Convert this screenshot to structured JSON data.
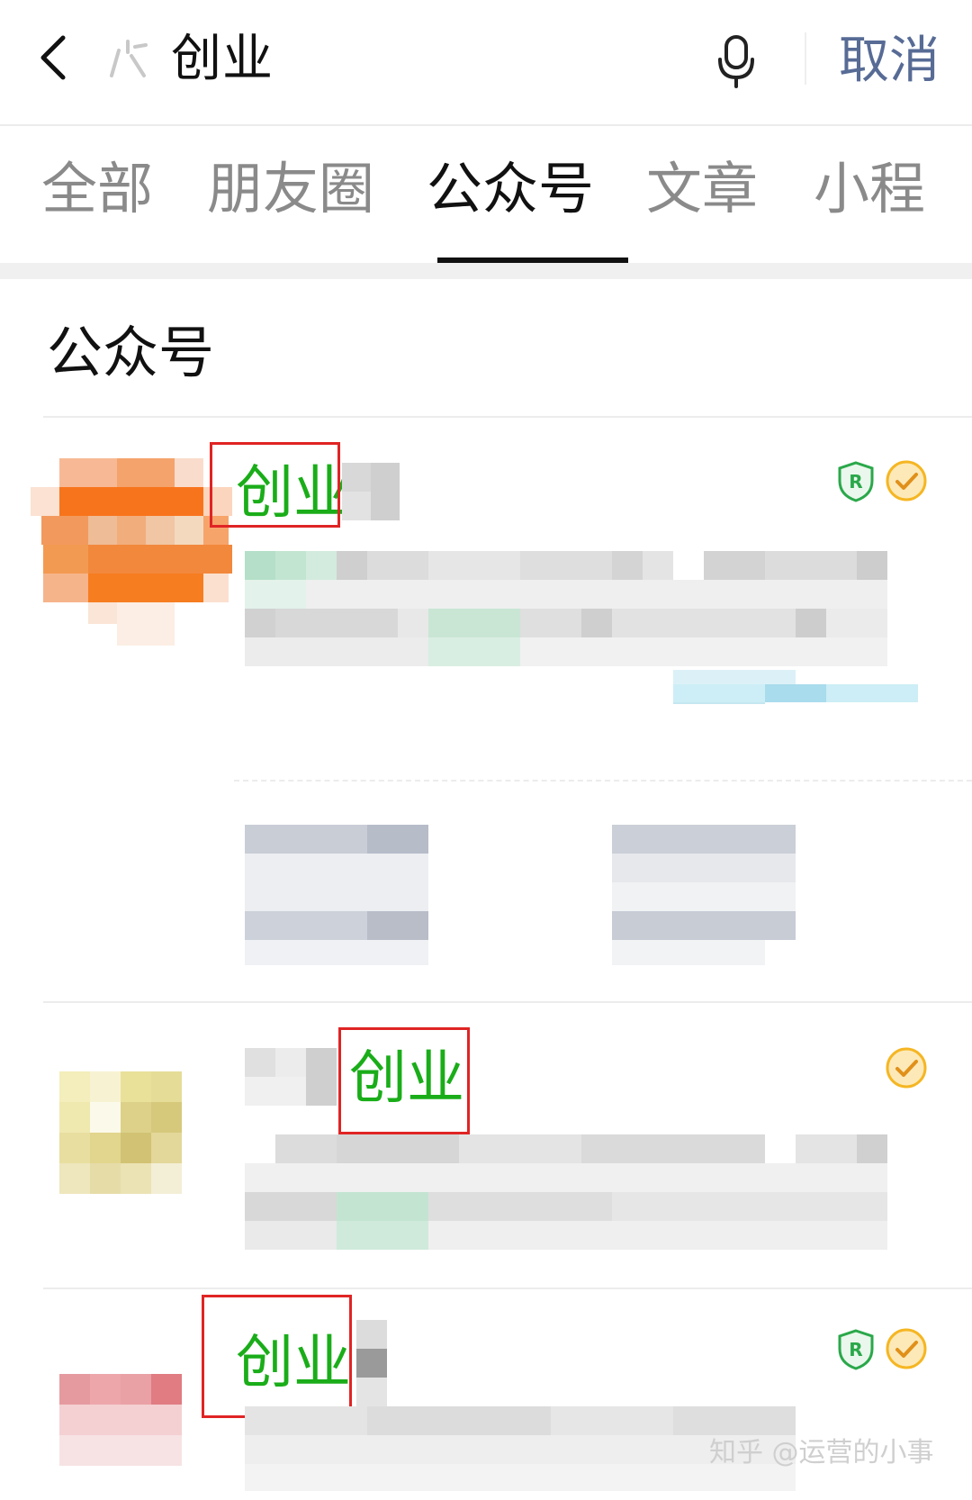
{
  "header": {
    "query": "创业",
    "cancel_label": "取消"
  },
  "tabs": [
    {
      "label": "全部",
      "active": false
    },
    {
      "label": "朋友圈",
      "active": false
    },
    {
      "label": "公众号",
      "active": true
    },
    {
      "label": "文章",
      "active": false
    },
    {
      "label": "小程",
      "active": false
    }
  ],
  "section": {
    "title": "公众号"
  },
  "results": [
    {
      "name_highlight": "创业",
      "badges": [
        "shield-r-icon",
        "verified-check-icon"
      ]
    },
    {
      "name_highlight": "创业",
      "badges": [
        "verified-check-icon"
      ]
    },
    {
      "name_highlight": "创业",
      "badges": [
        "shield-r-icon",
        "verified-check-icon"
      ]
    }
  ],
  "watermark": "知乎 @运营的小事",
  "colors": {
    "highlight": "#1aad19",
    "link": "#576b95",
    "annotation": "#e02424",
    "badge_gold": "#f5b623",
    "badge_green": "#2aa84a"
  }
}
